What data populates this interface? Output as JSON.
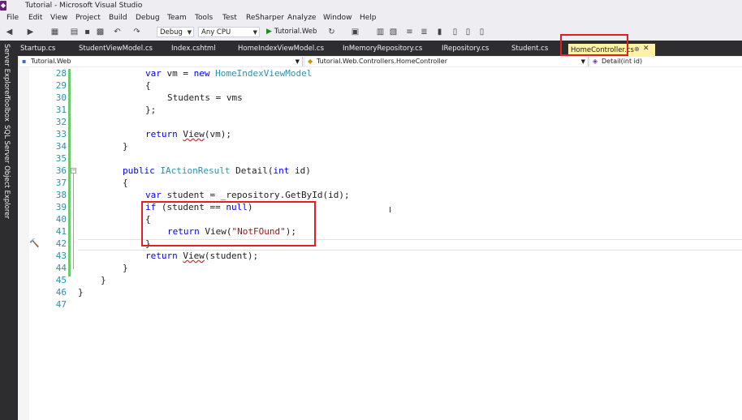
{
  "window": {
    "title": "Tutorial - Microsoft Visual Studio"
  },
  "menu": [
    "File",
    "Edit",
    "View",
    "Project",
    "Build",
    "Debug",
    "Team",
    "Tools",
    "Test",
    "ReSharper",
    "Analyze",
    "Window",
    "Help"
  ],
  "toolbar": {
    "configuration": "Debug",
    "platform": "Any CPU",
    "start_target": "Tutorial.Web"
  },
  "side_rail": [
    "Server Explorer",
    "Toolbox",
    "SQL Server Object Explorer"
  ],
  "tabs": [
    "Startup.cs",
    "StudentViewModel.cs",
    "Index.cshtml",
    "HomeIndexViewModel.cs",
    "InMemoryRepository.cs",
    "IRepository.cs",
    "Student.cs"
  ],
  "active_tab": "HomeController.cs",
  "navbar": {
    "project": "Tutorial.Web",
    "type": "Tutorial.Web.Controllers.HomeController",
    "member": "Detail(int id)"
  },
  "code": {
    "line_numbers": [
      "28",
      "29",
      "30",
      "31",
      "32",
      "33",
      "34",
      "35",
      "36",
      "37",
      "38",
      "39",
      "40",
      "41",
      "42",
      "43",
      "44",
      "45",
      "46",
      "47"
    ],
    "l28_kw1": "var",
    "l28_id": " vm = ",
    "l28_kw2": "new",
    "l28_type": " HomeIndexViewModel",
    "l29": "{",
    "l30": "Students = vms",
    "l31": "};",
    "l33_kw": "return",
    "l33_pre": " ",
    "l33_call": "View",
    "l33_rest": "(vm);",
    "l34": "}",
    "l36_kw": "public",
    "l36_type": " IActionResult",
    "l36_name": " Detail(",
    "l36_kw2": "int",
    "l36_rest": " id)",
    "l37": "{",
    "l38_kw": "var",
    "l38_rest": " student = _repository.GetById(id);",
    "l39_kw": "if",
    "l39_mid": " (student == ",
    "l39_kw2": "null",
    "l39_end": ")",
    "l40": "{",
    "l41_kw": "return",
    "l41_mid": " View(",
    "l41_str": "\"NotFOund\"",
    "l41_end": ");",
    "l42": "}",
    "l43_kw": "return",
    "l43_pre": " ",
    "l43_call": "View",
    "l43_rest": "(student);",
    "l44": "}",
    "l45": "}",
    "l46": "}"
  }
}
